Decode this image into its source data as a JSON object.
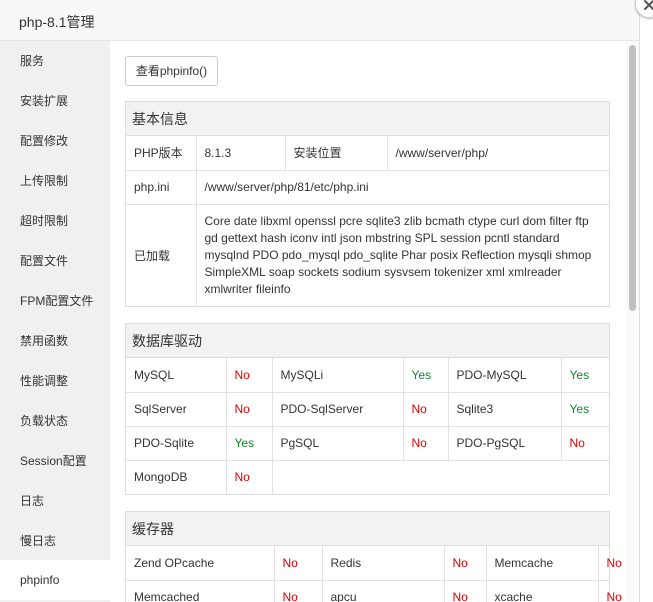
{
  "window": {
    "title": "php-8.1管理"
  },
  "sidebar": {
    "items": [
      {
        "label": "服务"
      },
      {
        "label": "安装扩展"
      },
      {
        "label": "配置修改"
      },
      {
        "label": "上传限制"
      },
      {
        "label": "超时限制"
      },
      {
        "label": "配置文件"
      },
      {
        "label": "FPM配置文件"
      },
      {
        "label": "禁用函数"
      },
      {
        "label": "性能调整"
      },
      {
        "label": "负载状态"
      },
      {
        "label": "Session配置"
      },
      {
        "label": "日志"
      },
      {
        "label": "慢日志"
      },
      {
        "label": "phpinfo"
      }
    ],
    "active_index": 13
  },
  "content": {
    "phpinfo_button": "查看phpinfo()",
    "basic_info": {
      "heading": "基本信息",
      "version_label": "PHP版本",
      "version_value": "8.1.3",
      "location_label": "安装位置",
      "location_value": "/www/server/php/",
      "ini_label": "php.ini",
      "ini_value": "/www/server/php/81/etc/php.ini",
      "loaded_label": "已加载",
      "loaded_value": "Core date libxml openssl pcre sqlite3 zlib bcmath ctype curl dom filter ftp gd gettext hash iconv intl json mbstring SPL session pcntl standard mysqlnd PDO pdo_mysql pdo_sqlite Phar posix Reflection mysqli shmop SimpleXML soap sockets sodium sysvsem tokenizer xml xmlreader xmlwriter fileinfo"
    },
    "db_drivers": {
      "heading": "数据库驱动",
      "rows": [
        [
          {
            "name": "MySQL",
            "status": "No"
          },
          {
            "name": "MySQLi",
            "status": "Yes"
          },
          {
            "name": "PDO-MySQL",
            "status": "Yes"
          }
        ],
        [
          {
            "name": "SqlServer",
            "status": "No"
          },
          {
            "name": "PDO-SqlServer",
            "status": "No"
          },
          {
            "name": "Sqlite3",
            "status": "Yes"
          }
        ],
        [
          {
            "name": "PDO-Sqlite",
            "status": "Yes"
          },
          {
            "name": "PgSQL",
            "status": "No"
          },
          {
            "name": "PDO-PgSQL",
            "status": "No"
          }
        ],
        [
          {
            "name": "MongoDB",
            "status": "No"
          }
        ]
      ]
    },
    "cache": {
      "heading": "缓存器",
      "rows": [
        [
          {
            "name": "Zend OPcache",
            "status": "No"
          },
          {
            "name": "Redis",
            "status": "No"
          },
          {
            "name": "Memcache",
            "status": "No"
          }
        ],
        [
          {
            "name": "Memcached",
            "status": "No"
          },
          {
            "name": "apcu",
            "status": "No"
          },
          {
            "name": "xcache",
            "status": "No"
          }
        ]
      ]
    }
  },
  "colors": {
    "yes": "#0a8a2a",
    "no": "#e00000",
    "sidebar_bg": "#f0f0f0",
    "panel_head_bg": "#f2f2f2"
  }
}
